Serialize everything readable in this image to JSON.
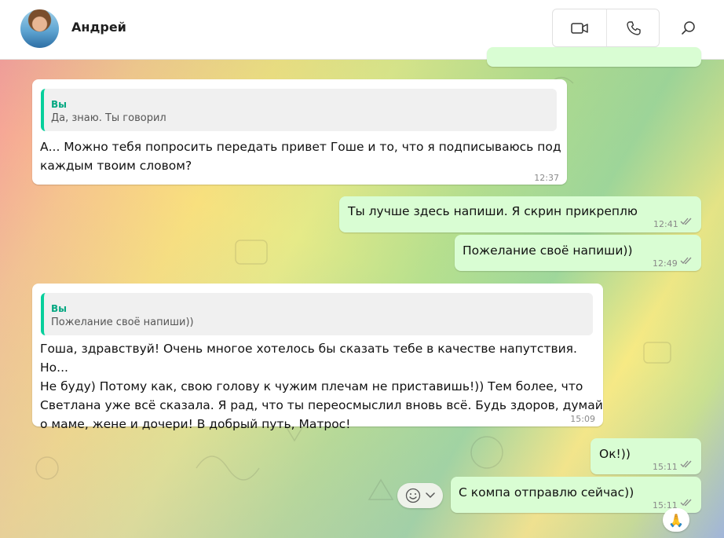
{
  "header": {
    "contact_name": "Андрей",
    "icons": {
      "video": "video-camera-icon",
      "voice": "phone-icon",
      "search": "search-icon"
    }
  },
  "colors": {
    "incoming_bubble": "#ffffff",
    "outgoing_bubble": "#d9fdd3",
    "quote_accent": "#06cf9c",
    "read_ticks": "#53bdeb"
  },
  "messages": [
    {
      "direction": "in",
      "quote_author": "Вы",
      "quote_text": "Да, знаю. Ты говорил",
      "text": "А... Можно тебя попросить передать привет Гоше и то, что я подписываюсь под\nкаждым твоим словом?",
      "time": "12:37"
    },
    {
      "direction": "out",
      "text": "Ты лучше здесь напиши. Я скрин прикреплю",
      "time": "12:41"
    },
    {
      "direction": "out",
      "text": "Пожелание своё напиши))",
      "time": "12:49"
    },
    {
      "direction": "in",
      "quote_author": "Вы",
      "quote_text": "Пожелание своё напиши))",
      "text": "Гоша, здравствуй! Очень многое хотелось бы сказать тебе в качестве напутствия. Но...\nНе буду) Потому как, свою голову к чужим плечам не приставишь!)) Тем более, что\nСветлана уже всё сказала. Я рад, что ты переосмыслил вновь всё. Будь здоров, думай\nо маме, жене и дочери! В добрый путь, Матрос!",
      "time": "15:09"
    },
    {
      "direction": "out",
      "text": "Ок!))",
      "time": "15:11"
    },
    {
      "direction": "out",
      "text": "С компа отправлю сейчас))",
      "time": "15:11",
      "reaction": "🙏"
    }
  ],
  "emoji_picker": {
    "icon": "smiley-icon",
    "chevron": "chevron-down-icon"
  }
}
